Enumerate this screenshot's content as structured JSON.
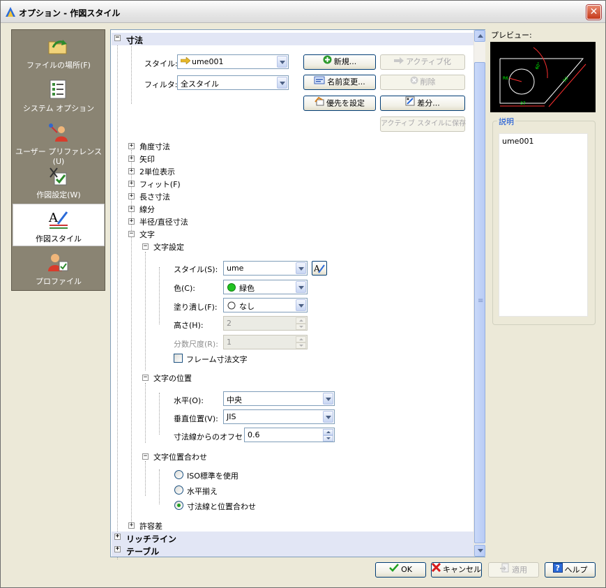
{
  "window": {
    "title": "オプション - 作図スタイル"
  },
  "nav": {
    "items": [
      {
        "label": "ファイルの場所(F)",
        "icon": "folder-arrow-icon"
      },
      {
        "label": "システム オプション",
        "icon": "checklist-icon"
      },
      {
        "label": "ユーザー プリファレンス(U)",
        "icon": "user-preferences-icon"
      },
      {
        "label": "作図設定(W)",
        "icon": "drawing-settings-icon"
      },
      {
        "label": "作図スタイル",
        "icon": "drawing-style-icon",
        "active": true
      },
      {
        "label": "プロファイル",
        "icon": "profile-icon"
      }
    ]
  },
  "dim": {
    "section_title": "寸法",
    "style_label": "スタイル:",
    "style_value": "ume001",
    "filter_label": "フィルタ:",
    "filter_value": "全スタイル",
    "buttons": {
      "new": "新規...",
      "set_active": "アクティブ化",
      "rename": "名前変更...",
      "delete": "削除",
      "set_priority": "優先を設定",
      "difference": "差分...",
      "save_active": "アクティブ スタイルに保存"
    },
    "tree": {
      "angle": "角度寸法",
      "arrow": "矢印",
      "dual": "2単位表示",
      "fit": "フィット(F)",
      "linear": "長さ寸法",
      "lines": "線分",
      "radius": "半径/直径寸法",
      "text": "文字",
      "tolerance": "許容差"
    },
    "text_settings": {
      "title": "文字設定",
      "style_label": "スタイル(S):",
      "style_value": "ume",
      "color_label": "色(C):",
      "color_value": "緑色",
      "fill_label": "塗り潰し(F):",
      "fill_value": "なし",
      "height_label": "高さ(H):",
      "height_value": "2",
      "fraction_label": "分数尺度(R):",
      "fraction_value": "1",
      "frame_label": "フレーム寸法文字",
      "frame_checked": false
    },
    "text_position": {
      "title": "文字の位置",
      "horizontal_label": "水平(O):",
      "horizontal_value": "中央",
      "vertical_label": "垂直位置(V):",
      "vertical_value": "JIS",
      "offset_label": "寸法線からのオフセット(D):",
      "offset_value": "0.6"
    },
    "text_alignment": {
      "title": "文字位置合わせ",
      "options": [
        "ISO標準を使用",
        "水平揃え",
        "寸法線と位置合わせ"
      ],
      "selected_index": 2
    }
  },
  "sections": {
    "leader": "リッチライン",
    "table": "テーブル"
  },
  "preview": {
    "label": "プレビュー:",
    "numbers": {
      "radius": "R6",
      "angle": "60°",
      "length": "50",
      "bottom": "37"
    }
  },
  "description": {
    "label": "説明",
    "text": "ume001"
  },
  "footer": {
    "ok": "OK",
    "cancel": "キャンセル",
    "apply": "適用",
    "help": "ヘルプ"
  },
  "colors": {
    "accent": "#003c74",
    "selected_bg": "#e2e6f5",
    "green": "#21a121",
    "cancel_red": "#d81c1c"
  }
}
